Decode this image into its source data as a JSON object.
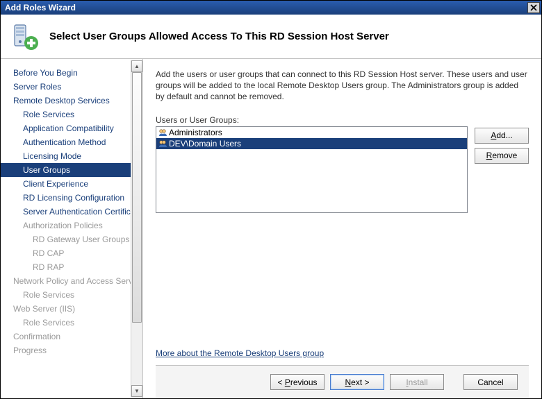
{
  "window": {
    "title": "Add Roles Wizard"
  },
  "header": {
    "title": "Select User Groups Allowed Access To This RD Session Host Server"
  },
  "sidebar": {
    "items": [
      {
        "label": "Before You Begin",
        "level": 1,
        "enabled": true
      },
      {
        "label": "Server Roles",
        "level": 1,
        "enabled": true
      },
      {
        "label": "Remote Desktop Services",
        "level": 1,
        "enabled": true
      },
      {
        "label": "Role Services",
        "level": 2,
        "enabled": true
      },
      {
        "label": "Application Compatibility",
        "level": 2,
        "enabled": true
      },
      {
        "label": "Authentication Method",
        "level": 2,
        "enabled": true
      },
      {
        "label": "Licensing Mode",
        "level": 2,
        "enabled": true
      },
      {
        "label": "User Groups",
        "level": 2,
        "enabled": true,
        "selected": true
      },
      {
        "label": "Client Experience",
        "level": 2,
        "enabled": true
      },
      {
        "label": "RD Licensing Configuration",
        "level": 2,
        "enabled": true
      },
      {
        "label": "Server Authentication Certificate",
        "level": 2,
        "enabled": true
      },
      {
        "label": "Authorization Policies",
        "level": 2,
        "enabled": false
      },
      {
        "label": "RD Gateway User Groups",
        "level": 3,
        "enabled": false
      },
      {
        "label": "RD CAP",
        "level": 3,
        "enabled": false
      },
      {
        "label": "RD RAP",
        "level": 3,
        "enabled": false
      },
      {
        "label": "Network Policy and Access Services",
        "level": 1,
        "enabled": false
      },
      {
        "label": "Role Services",
        "level": 2,
        "enabled": false
      },
      {
        "label": "Web Server (IIS)",
        "level": 1,
        "enabled": false
      },
      {
        "label": "Role Services",
        "level": 2,
        "enabled": false
      },
      {
        "label": "Confirmation",
        "level": 1,
        "enabled": false
      },
      {
        "label": "Progress",
        "level": 1,
        "enabled": false
      }
    ]
  },
  "main": {
    "description": "Add the users or user groups that can connect to this RD Session Host server. These users and user groups will be added to the local Remote Desktop Users group. The Administrators group is added by default and cannot be removed.",
    "list_label": "Users or User Groups:",
    "groups": [
      {
        "name": "Administrators",
        "selected": false
      },
      {
        "name": "DEV\\Domain Users",
        "selected": true
      }
    ],
    "add_label": "Add...",
    "remove_label": "Remove",
    "link_text": "More about the Remote Desktop Users group"
  },
  "footer": {
    "previous": "< Previous",
    "next": "Next >",
    "install": "Install",
    "cancel": "Cancel"
  }
}
